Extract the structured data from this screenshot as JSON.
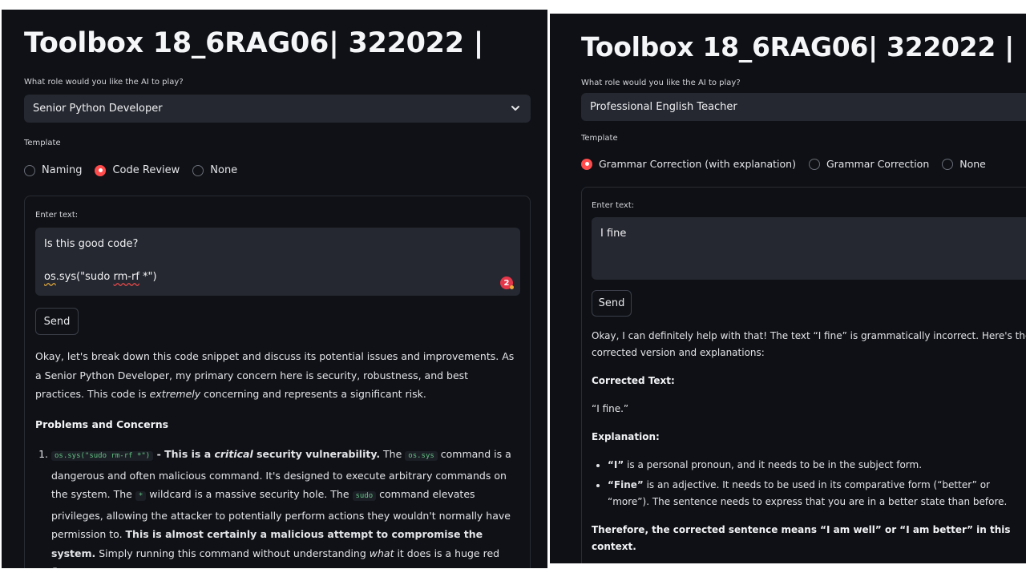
{
  "left": {
    "title": "Toolbox 18_6RAG06| 322022 |",
    "role_label": "What role would you like the AI to play?",
    "role_value": "Senior Python Developer",
    "template_label": "Template",
    "template_options": [
      "Naming",
      "Code Review",
      "None"
    ],
    "template_selected": "Code Review",
    "enter_text_label": "Enter text:",
    "input_line1": "Is this good code?",
    "input_os": "os",
    "input_sys": ".sys(\"sudo ",
    "input_rmrf": "rm-rf",
    "input_tail": " *\")",
    "input_badge": "2",
    "send_label": "Send",
    "response": {
      "intro_a": "Okay, let's break down this code snippet and discuss its potential issues and improvements. As a Senior Python Developer, my primary concern here is security, robustness, and best practices. This code is ",
      "intro_em": "extremely",
      "intro_b": " concerning and represents a significant risk.",
      "heading": "Problems and Concerns",
      "item1_code": "os.sys(\"sudo rm-rf *\")",
      "item1_bold_a": " - This is a ",
      "item1_em": "critical",
      "item1_bold_b": " security vulnerability.",
      "item1_t1": " The ",
      "item1_code2": "os.sys",
      "item1_t2": " command is a dangerous and often malicious command. It's designed to execute arbitrary commands on the system. The ",
      "item1_code3": "*",
      "item1_t3": " wildcard is a massive security hole. The ",
      "item1_code4": "sudo",
      "item1_t4": " command elevates privileges, allowing the attacker to potentially perform actions they wouldn't normally have permission to. ",
      "item1_bold_c": "This is almost certainly a malicious attempt to compromise the system.",
      "item1_t5": " Simply running this command without understanding ",
      "item1_em2": "what",
      "item1_t6": " it does is a huge red flag."
    }
  },
  "right": {
    "title": "Toolbox 18_6RAG06| 322022 |",
    "role_label": "What role would you like the AI to play?",
    "role_value": "Professional English Teacher",
    "template_label": "Template",
    "template_options": [
      "Grammar Correction (with explanation)",
      "Grammar Correction",
      "None"
    ],
    "template_selected": "Grammar Correction (with explanation)",
    "enter_text_label": "Enter text:",
    "input_value": "I fine",
    "send_label": "Send",
    "response": {
      "intro": "Okay, I can definitely help with that! The text “I fine” is grammatically incorrect. Here's the corrected version and explanations:",
      "corrected_heading": "Corrected Text:",
      "corrected_value": "“I fine.”",
      "explanation_heading": "Explanation:",
      "b1_bold": "“I”",
      "b1_text": " is a personal pronoun, and it needs to be in the subject form.",
      "b2_bold": "“Fine”",
      "b2_text": " is an adjective. It needs to be used in its comparative form (“better” or “more”). The sentence needs to express that you are in a better state than before.",
      "conclusion": "Therefore, the corrected sentence means “I am well” or “I am better” in this context."
    }
  }
}
